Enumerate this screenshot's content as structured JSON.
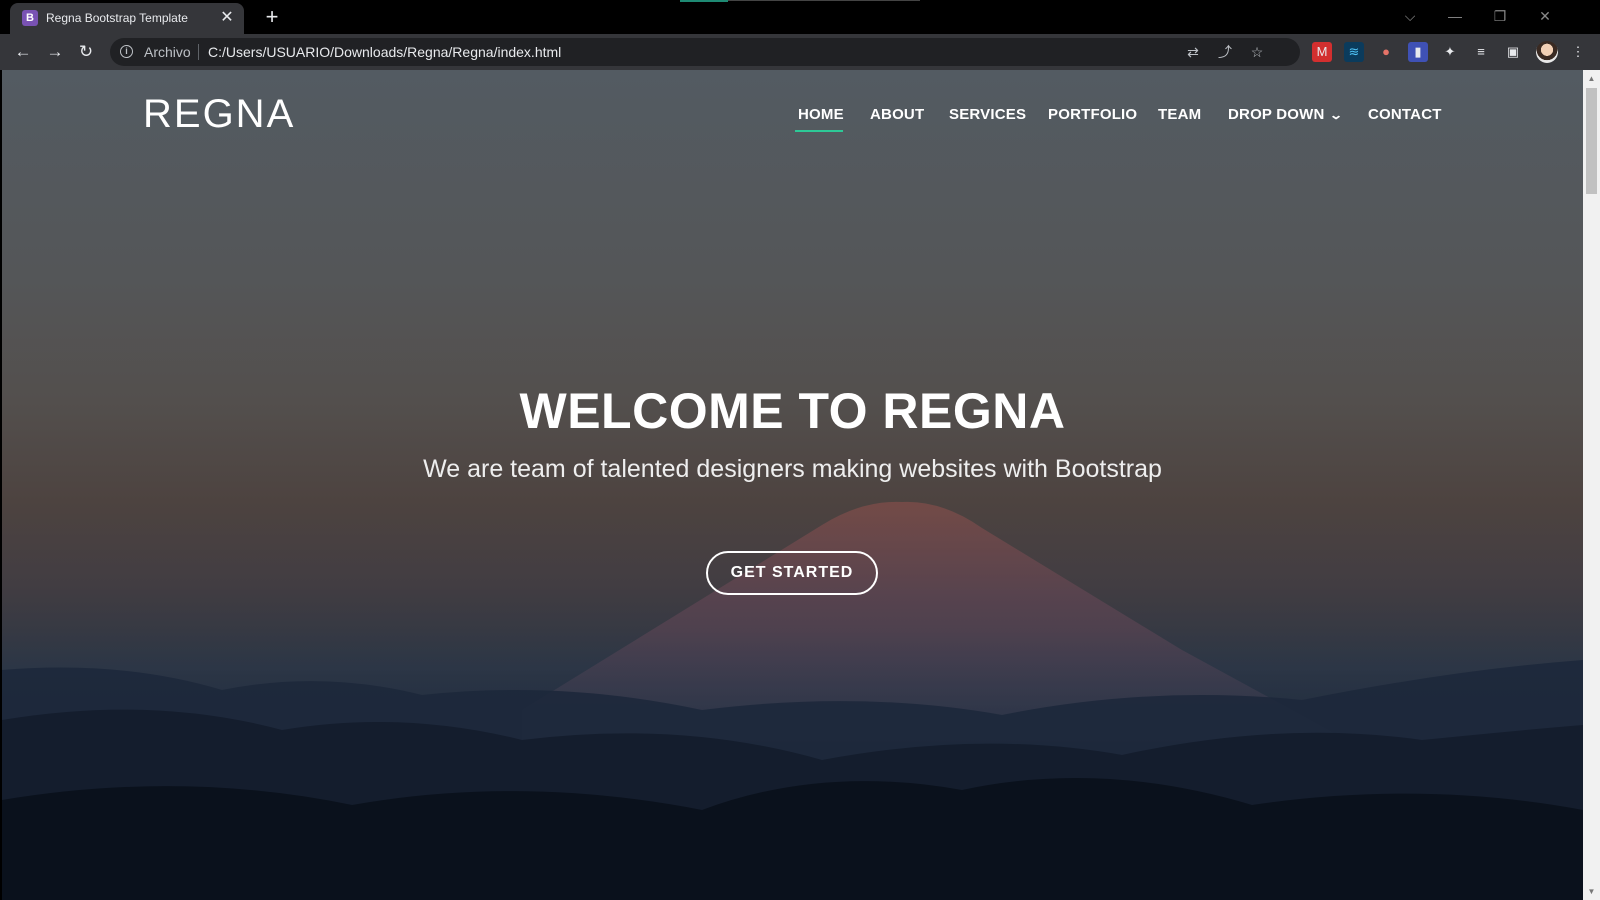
{
  "browser": {
    "tab": {
      "favicon_letter": "B",
      "title": "Regna Bootstrap Template",
      "close": "✕"
    },
    "new_tab": "+",
    "window_controls": {
      "tabsearch": "⌵",
      "minimize": "—",
      "restore": "❐",
      "close": "✕"
    },
    "toolbar": {
      "back": "←",
      "forward": "→",
      "reload": "↻",
      "info_icon": "i",
      "site_label": "Archivo",
      "url": "C:/Users/USUARIO/Downloads/Regna/Regna/index.html",
      "translate_icon": "⇄",
      "share_icon": "⤴",
      "star_icon": "☆",
      "extensions": [
        "M",
        "≋",
        "●",
        "▮"
      ],
      "puzzle_icon": "✦",
      "media_icon": "≡",
      "sidepanel_icon": "▣",
      "menu_icon": "⋮"
    },
    "colors": {
      "accent": "#2dc997"
    }
  },
  "site": {
    "logo": "REGNA",
    "nav": [
      {
        "label": "HOME",
        "active": true
      },
      {
        "label": "ABOUT"
      },
      {
        "label": "SERVICES"
      },
      {
        "label": "PORTFOLIO"
      },
      {
        "label": "TEAM"
      },
      {
        "label": "DROP DOWN",
        "dropdown": true
      },
      {
        "label": "CONTACT"
      }
    ],
    "hero": {
      "title": "WELCOME TO REGNA",
      "subtitle": "We are team of talented designers making websites with Bootstrap",
      "cta": "GET STARTED"
    }
  }
}
